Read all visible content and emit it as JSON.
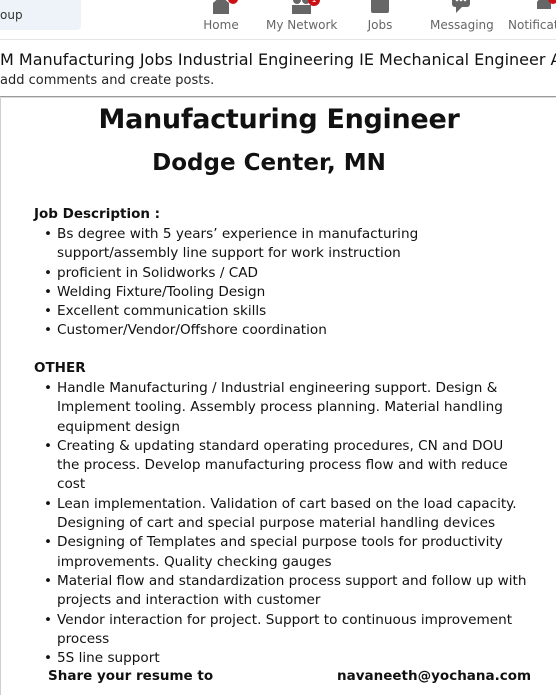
{
  "search": {
    "partial_text": "oup"
  },
  "nav": {
    "items": [
      {
        "label": "Home",
        "icon": "home-icon",
        "badge": ""
      },
      {
        "label": "My Network",
        "icon": "network-icon",
        "badge": "1"
      },
      {
        "label": "Jobs",
        "icon": "briefcase-icon",
        "badge": ""
      },
      {
        "label": "Messaging",
        "icon": "messaging-icon",
        "badge": ""
      },
      {
        "label": "Notificati",
        "icon": "bell-icon",
        "badge": ""
      }
    ]
  },
  "group": {
    "title": "M Manufacturing Jobs Industrial Engineering IE Mechanical Engineer Automo",
    "subtitle": "add comments and create posts."
  },
  "post": {
    "title": "Manufacturing Engineer",
    "location": "Dodge Center, MN",
    "job_description_heading": "Job Description :",
    "job_description": [
      "Bs degree with 5 years’ experience in manufacturing support/assembly line support for work instruction",
      "proficient in Solidworks / CAD",
      "Welding Fixture/Tooling Design",
      "Excellent communication skills",
      "Customer/Vendor/Offshore coordination"
    ],
    "other_heading": "OTHER",
    "other": [
      "Handle Manufacturing / Industrial engineering support. Design & Implement tooling. Assembly process planning. Material handling equipment design",
      "Creating & updating standard operating procedures, CN and DOU the process. Develop manufacturing process flow and with reduce cost",
      "Lean implementation. Validation of cart based on the load capacity. Designing of cart and special purpose material handling devices",
      "Designing of Templates and special purpose tools for productivity improvements. Quality checking gauges",
      "Material flow and standardization process support and follow up with projects and interaction with customer",
      "Vendor interaction for project. Support to continuous improvement process",
      "5S line support"
    ],
    "share_label": "Share your resume to",
    "email": "navaneeth@yochana.com"
  },
  "colors": {
    "badge": "#cc1016",
    "search_bg": "#edf3f8",
    "nav_icon": "#666666"
  }
}
